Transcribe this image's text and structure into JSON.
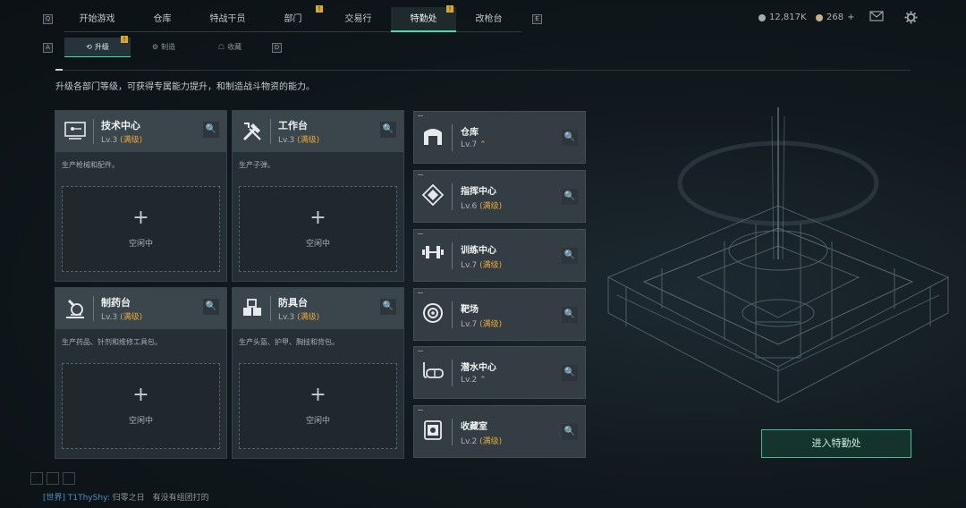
{
  "topbar": {
    "left_key": "Q",
    "right_key": "E",
    "tabs": [
      {
        "label": "开始游戏",
        "badge": ""
      },
      {
        "label": "仓库",
        "badge": ""
      },
      {
        "label": "特战干员",
        "badge": ""
      },
      {
        "label": "部门",
        "badge": "!"
      },
      {
        "label": "交易行",
        "badge": ""
      },
      {
        "label": "特勤处",
        "badge": "!",
        "active": true
      },
      {
        "label": "改枪台",
        "badge": ""
      }
    ],
    "currency_1": "12,817K",
    "currency_2": "268",
    "currency_2_add": "+",
    "mail_icon": "mail-icon",
    "settings_icon": "gear-icon"
  },
  "subtabs": {
    "left_key": "A",
    "right_key": "D",
    "items": [
      {
        "label": "升级",
        "icon": "upgrade-icon",
        "badge": "!"
      },
      {
        "label": "制造",
        "icon": "craft-icon",
        "badge": ""
      },
      {
        "label": "收藏",
        "icon": "collection-icon",
        "badge": ""
      }
    ]
  },
  "description": "升级各部门等级，可获得专属能力提升，和制造战斗物资的能力。",
  "cards": [
    {
      "name": "技术中心",
      "level": "Lv.3",
      "max": "(满级)",
      "sub": "生产枪械和配件。",
      "idle": "空闲中",
      "icon": "tech-center-icon"
    },
    {
      "name": "工作台",
      "level": "Lv.3",
      "max": "(满级)",
      "sub": "生产子弹。",
      "idle": "空闲中",
      "icon": "workbench-icon"
    },
    {
      "name": "制药台",
      "level": "Lv.3",
      "max": "(满级)",
      "sub": "生产药品、针剂和维修工具包。",
      "idle": "空闲中",
      "icon": "pharmacy-icon"
    },
    {
      "name": "防具台",
      "level": "Lv.3",
      "max": "(满级)",
      "sub": "生产头盔、护甲、胸挂和背包。",
      "idle": "空闲中",
      "icon": "armor-bench-icon"
    }
  ],
  "rows": [
    {
      "name": "仓库",
      "level": "Lv.7",
      "max": "",
      "up": "⌃",
      "icon": "warehouse-icon"
    },
    {
      "name": "指挥中心",
      "level": "Lv.6",
      "max": "(满级)",
      "up": "",
      "icon": "command-center-icon"
    },
    {
      "name": "训练中心",
      "level": "Lv.7",
      "max": "(满级)",
      "up": "",
      "icon": "training-center-icon"
    },
    {
      "name": "靶场",
      "level": "Lv.7",
      "max": "(满级)",
      "up": "",
      "icon": "shooting-range-icon"
    },
    {
      "name": "潜水中心",
      "level": "Lv.2",
      "max": "",
      "up": "⌃",
      "icon": "diving-center-icon"
    },
    {
      "name": "收藏室",
      "level": "Lv.2",
      "max": "(满级)",
      "up": "",
      "icon": "collection-room-icon"
    }
  ],
  "enter_button": "进入特勤处",
  "chat": {
    "channel": "[世界]",
    "user": "T1ThyShy:",
    "text": "归零之日　有没有组团打的"
  },
  "colors": {
    "accent": "#3fe0b0",
    "max_level": "#e2a93b",
    "badge": "#d7a92c"
  }
}
